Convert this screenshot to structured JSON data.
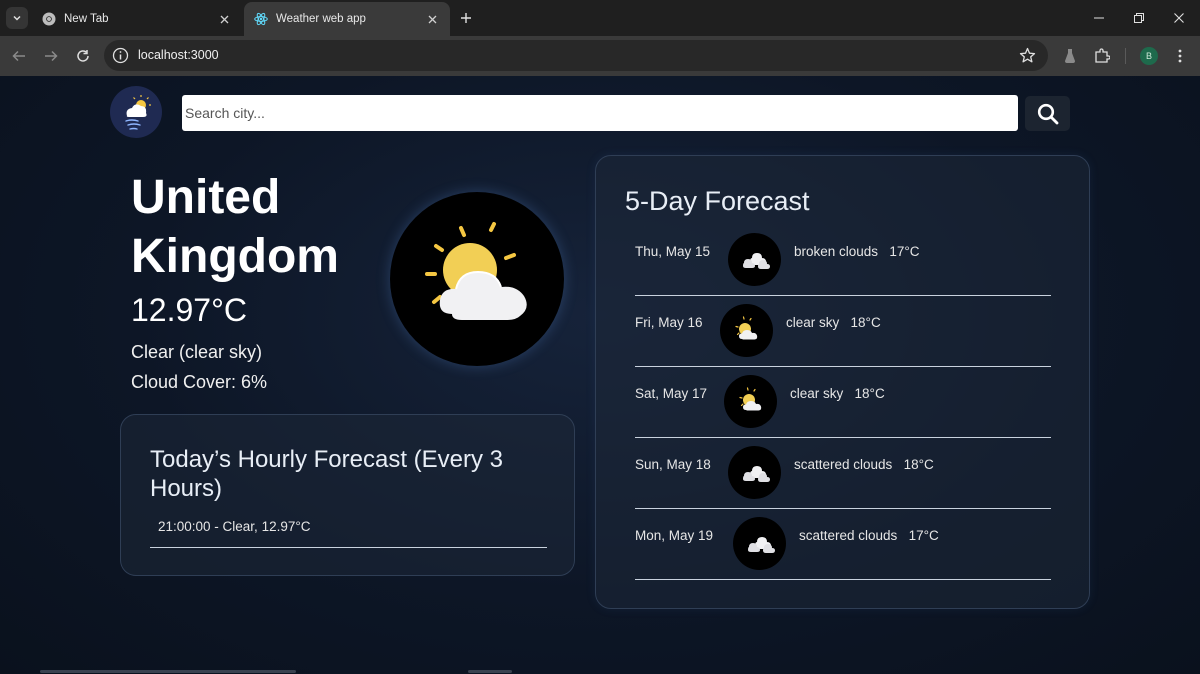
{
  "browser": {
    "tabs": [
      {
        "title": "New Tab",
        "icon": "chrome-icon",
        "active": false
      },
      {
        "title": "Weather web app",
        "icon": "react-icon",
        "active": true
      }
    ],
    "url": "localhost:3000",
    "profile_initial": "B"
  },
  "header": {
    "search_placeholder": "Search city..."
  },
  "current": {
    "city": "United Kingdom",
    "temperature": "12.97°C",
    "condition": "Clear (clear sky)",
    "cloud_cover": "Cloud Cover: 6%"
  },
  "hourly": {
    "title": "Today’s Hourly Forecast (Every 3 Hours)",
    "items": [
      "21:00:00 - Clear, 12.97°C"
    ]
  },
  "forecast": {
    "title": "5-Day Forecast",
    "days": [
      {
        "date": "Thu, May 15",
        "description": "broken clouds",
        "temp": "17°C",
        "icon": "clouds-icon"
      },
      {
        "date": "Fri, May 16",
        "description": "clear sky",
        "temp": "18°C",
        "icon": "sun-cloud-icon"
      },
      {
        "date": "Sat, May 17",
        "description": "clear sky",
        "temp": "18°C",
        "icon": "sun-cloud-icon"
      },
      {
        "date": "Sun, May 18",
        "description": "scattered clouds",
        "temp": "18°C",
        "icon": "clouds-icon"
      },
      {
        "date": "Mon, May 19",
        "description": "scattered clouds",
        "temp": "17°C",
        "icon": "clouds-icon"
      }
    ]
  },
  "colors": {
    "page_background": "#0b1320",
    "card_border": "#2f3e55",
    "sun": "#f5c742"
  }
}
